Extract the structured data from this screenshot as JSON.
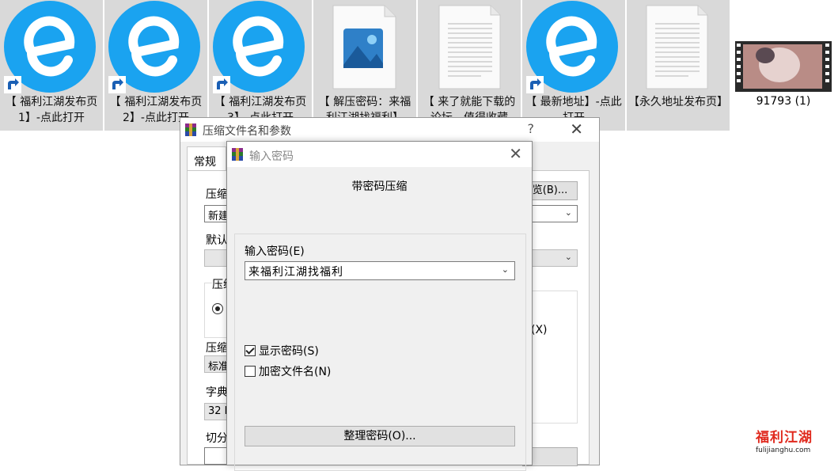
{
  "desktop": {
    "files": [
      {
        "caption": "【 福利江湖发布页1】-点此打开",
        "icon": "edge-browser-icon",
        "shortcut": true
      },
      {
        "caption": "【 福利江湖发布页2】-点此打开",
        "icon": "edge-browser-icon",
        "shortcut": true
      },
      {
        "caption": "【 福利江湖发布页3】-点此打开",
        "icon": "edge-browser-icon",
        "shortcut": true
      },
      {
        "caption": "【 解压密码：来福利江湖找福利】",
        "icon": "image-file-icon",
        "shortcut": false
      },
      {
        "caption": "【 来了就能下载的论坛，值得收藏",
        "icon": "text-document-icon",
        "shortcut": false
      },
      {
        "caption": "【 最新地址】-点此打开",
        "icon": "edge-browser-icon",
        "shortcut": true
      },
      {
        "caption": "【永久地址发布页】",
        "icon": "text-document-icon",
        "shortcut": false
      },
      {
        "caption": "91793 (1)",
        "icon": "video-thumbnail-icon",
        "shortcut": false
      }
    ]
  },
  "archive_window": {
    "title": "压缩文件名和参数",
    "help": "?",
    "close": "✕",
    "tab_general": "常规",
    "label_archive_name": "压缩",
    "archive_name_value": "新建",
    "browse_button": "览(B)...",
    "label_default": "默认",
    "label_format": "压缩",
    "label_method": "压缩",
    "method_value": "标准",
    "label_dict": "字典",
    "dict_value": "32 M",
    "label_split": "切分",
    "option_partial": "(X)"
  },
  "password_dialog": {
    "title": "输入密码",
    "close": "✕",
    "heading": "带密码压缩",
    "label_enter_password": "输入密码(E)",
    "password_value": "来福利江湖找福利",
    "show_password_label": "显示密码(S)",
    "show_password_checked": true,
    "encrypt_names_label": "加密文件名(N)",
    "encrypt_names_checked": false,
    "organize_button": "整理密码(O)..."
  },
  "watermark": {
    "main": "福利江湖",
    "sub": "fulijianghu.com"
  },
  "colors": {
    "edge_blue": "#1aa3f0",
    "tile_gray": "#d9d9d9",
    "watermark_red": "#e0291d"
  }
}
